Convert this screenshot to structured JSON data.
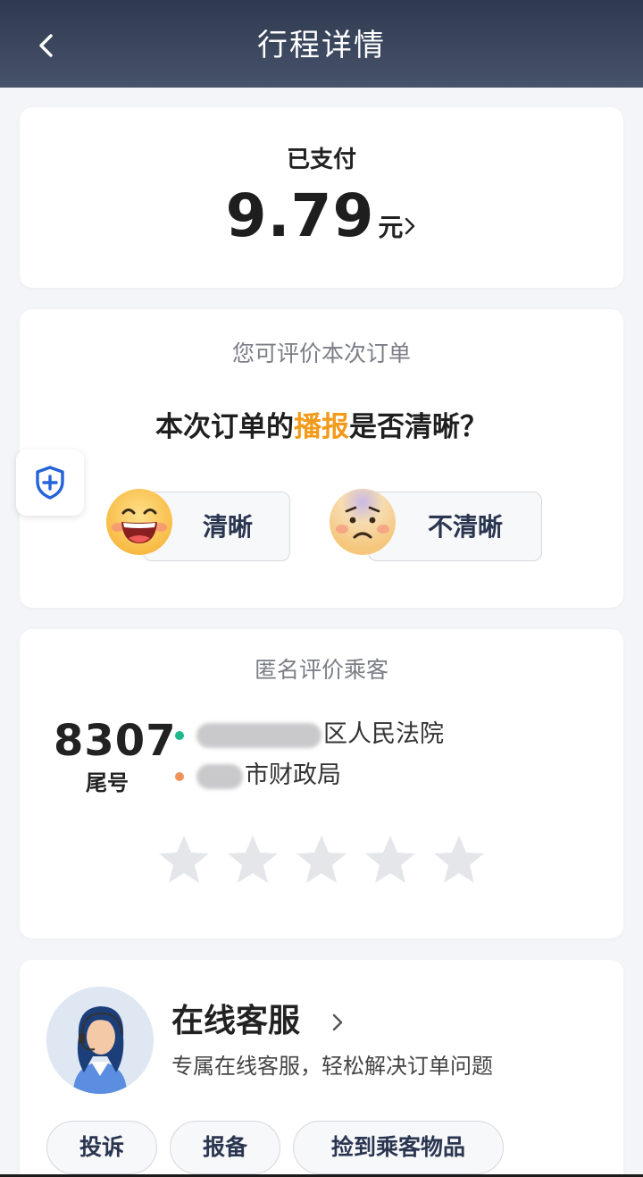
{
  "header": {
    "title": "行程详情",
    "back_icon": "chevron-left-icon"
  },
  "payment": {
    "status": "已支付",
    "amount": "9.79",
    "unit": "元"
  },
  "rating": {
    "prompt": "您可评价本次订单",
    "question_prefix": "本次订单的",
    "question_highlight": "播报",
    "question_suffix": "是否清晰？",
    "highlight_color": "#f29a1a",
    "options": [
      {
        "label": "清晰",
        "icon": "laughing-face-icon"
      },
      {
        "label": "不清晰",
        "icon": "worried-face-icon"
      }
    ]
  },
  "floating": {
    "icon": "shield-plus-icon"
  },
  "passenger": {
    "title": "匿名评价乘客",
    "tail_number": "8307",
    "tail_label": "尾号",
    "route_start": "区人民法院",
    "route_end": "市财政局",
    "star_count": 5,
    "rating": 0
  },
  "service": {
    "title": "在线客服",
    "subtitle": "专属在线客服，轻松解决订单问题",
    "buttons": [
      "投诉",
      "报备",
      "捡到乘客物品"
    ]
  }
}
